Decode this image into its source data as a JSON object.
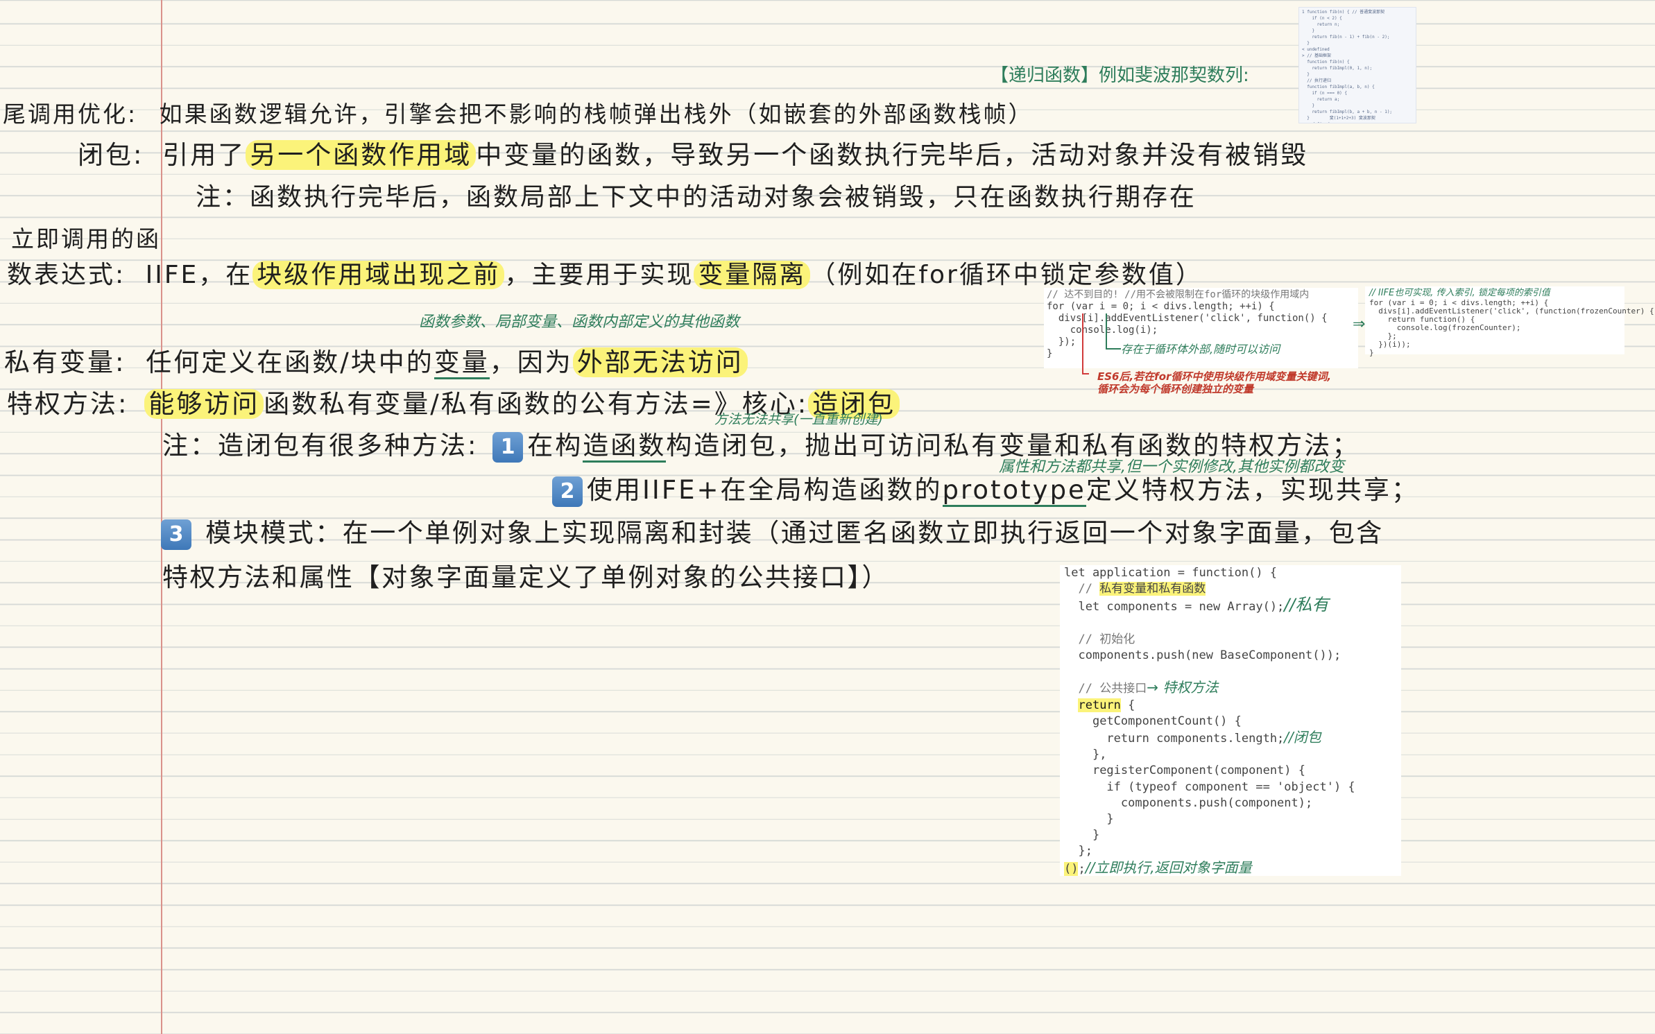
{
  "notes": {
    "tail_call": {
      "label": "尾调用优化:",
      "text": "如果函数逻辑允许，引擎会把不影响的栈帧弹出栈外（如嵌套的外部函数栈帧）"
    },
    "closure": {
      "label": "闭包:",
      "pre": "引用了",
      "highlight": "另一个函数作用域",
      "post": "中变量的函数，导致另一个函数执行完毕后，活动对象并没有被销毁"
    },
    "closure_note": "注：函数执行完毕后，函数局部上下文中的活动对象会被销毁，只在函数执行期存在",
    "iife": {
      "label_line1": "立即调用的函",
      "label_line2": "数表达式:",
      "pre": "IIFE，在",
      "highlight1": "块级作用域出现之前",
      "mid": "，主要用于实现",
      "highlight2": "变量隔离",
      "post": "（例如在for循环中锁定参数值）"
    },
    "private_ann": "函数参数、局部变量、函数内部定义的其他函数",
    "private": {
      "label": "私有变量:",
      "pre": "任何定义在函数/块中的",
      "underline": "变量",
      "mid": "，因为",
      "highlight": "外部无法访问"
    },
    "privileged": {
      "label": "特权方法:",
      "highlight1": "能够访问",
      "mid": "函数私有变量/私有函数的公有方法=》核心:",
      "highlight2": "造闭包"
    },
    "ctor_ann": "方法无法共享(一直重新创建)",
    "methods_note": {
      "prefix": "注：造闭包有很多种方法:",
      "num1": "1",
      "pre": "在构",
      "underline": "造函数",
      "post": "构造闭包，抛出可访问私有变量和私有函数的特权方法；"
    },
    "proto_ann": "属性和方法都共享,但一个实例修改,其他实例都改变",
    "method2": {
      "num": "2",
      "pre": "使用IIFE+在全局构造函数的",
      "underline": "prototype",
      "post": "定义特权方法，实现共享；"
    },
    "module": {
      "num": "3",
      "line1": "模块模式：在一个单例对象上实现隔离和封装（通过匿名函数立即执行返回一个对象字面量，包含",
      "line2": "特权方法和属性【对象字面量定义了单例对象的公共接口】）"
    }
  },
  "recursion": {
    "title": "【递归函数】例如斐波那契数列:"
  },
  "thumb_code": [
    "1 function fib(n) { // 普通斐波那契",
    "    if (n < 2) {",
    "      return n;",
    "    }",
    "    return fib(n - 1) + fib(n - 2);",
    "  }",
    "< undefined",
    "",
    "> // 基础框架",
    "  function fib(n) {",
    "    return fibImpl(0, 1, n);",
    "  }",
    "  // 执行递归",
    "  function fibImpl(a, b, n) {",
    "    if (n === 0) {",
    "      return a;",
    "    }",
    "    return fibImpl(b, a + b, n - 1);",
    "  }        斐(1+1+2+3) 斐波那契",
    "< undefined"
  ],
  "var_code": {
    "lines": [
      "// 达不到目的! //用不会被限制在for循环的块级作用域内",
      "for (var i = 0; i < divs.length; ++i) {",
      "  divs[i].addEventListener('click', function() {",
      "    console.log(i);",
      "  });",
      "}"
    ],
    "ann1": "存在于循环体外部,随时可以访问",
    "ann2": "ES6后,若在for循环中使用块级作用域变量关键词,",
    "ann3": "循环会为每个循环创建独立的变量"
  },
  "iife_code": {
    "comment": "// IIFE也可实现, 传入索引, 锁定每项的索引值",
    "lines": [
      "for (var i = 0; i < divs.length; ++i) {",
      "  divs[i].addEventListener('click', (function(frozenCounter) {",
      "    return function() {",
      "      console.log(frozenCounter);",
      "    };",
      "  })(i));",
      "}"
    ]
  },
  "module_code": {
    "l1": "let application = function() {",
    "l2_comment": "// ",
    "l2_hl": "私有变量和私有函数",
    "l3": "let components = new Array();",
    "l3_ann": "//私有",
    "l4": "// 初始化",
    "l5": "components.push(new BaseComponent());",
    "l6": "// 公共接口",
    "l6_ann": "→ 特权方法",
    "l7_kw": "return",
    "l7": " {",
    "l8": "  getComponentCount() {",
    "l9": "    return components.length;",
    "l9_ann": "//闭包",
    "l10": "  },",
    "l11": "  registerComponent(component) {",
    "l12": "    if (typeof component == 'object') {",
    "l13": "      components.push(component);",
    "l14": "    }",
    "l15": "  }",
    "l16": "};",
    "l17_hl": "()",
    "l17": ";",
    "l17_ann": "//立即执行,返回对象字面量"
  }
}
